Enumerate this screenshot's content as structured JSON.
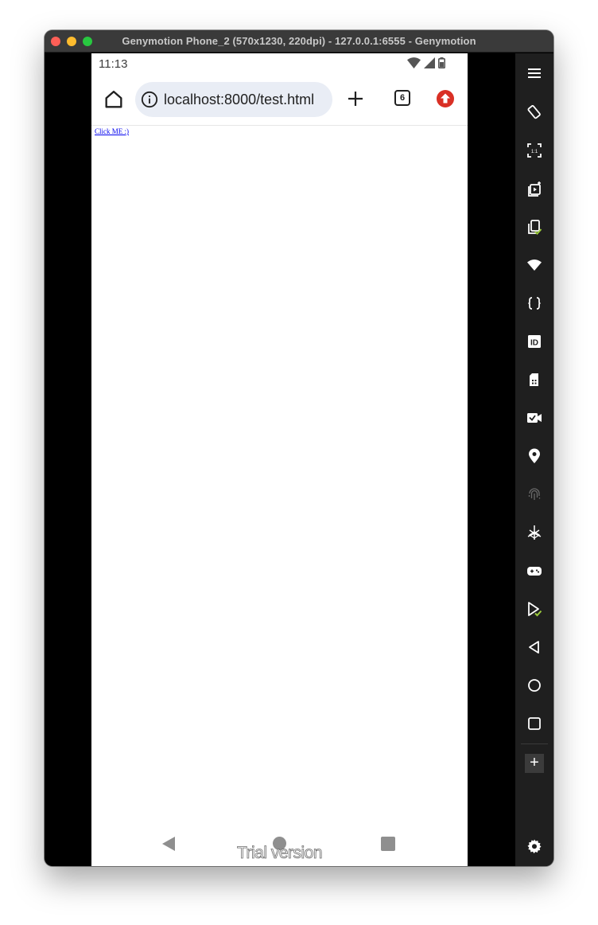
{
  "window": {
    "title": "Genymotion Phone_2 (570x1230, 220dpi) - 127.0.0.1:6555 - Genymotion"
  },
  "status_bar": {
    "time": "11:13"
  },
  "browser": {
    "url": "localhost:8000/test.html",
    "tab_count": "6"
  },
  "page": {
    "link_text": "Click ME :)"
  },
  "overlay": {
    "watermark": "Trial version"
  },
  "side_panel": {
    "icons": [
      "menu-icon",
      "rotate-icon",
      "pixel-perfect-icon",
      "screen-record-icon",
      "clipboard-icon",
      "wifi-icon",
      "json-icon",
      "id-icon",
      "sim-icon",
      "camera-icon",
      "location-icon",
      "fingerprint-icon",
      "motion-sensor-icon",
      "gamepad-icon",
      "capture-icon",
      "back-icon",
      "home-icon",
      "recent-apps-icon",
      "add-icon",
      "settings-icon"
    ],
    "add_label": "+"
  },
  "colors": {
    "link": "#0000ee",
    "side_panel": "#1f1f1f",
    "url_bar": "#e9edf5",
    "update_badge": "#d93025",
    "check_accent": "#9ccc3d"
  }
}
